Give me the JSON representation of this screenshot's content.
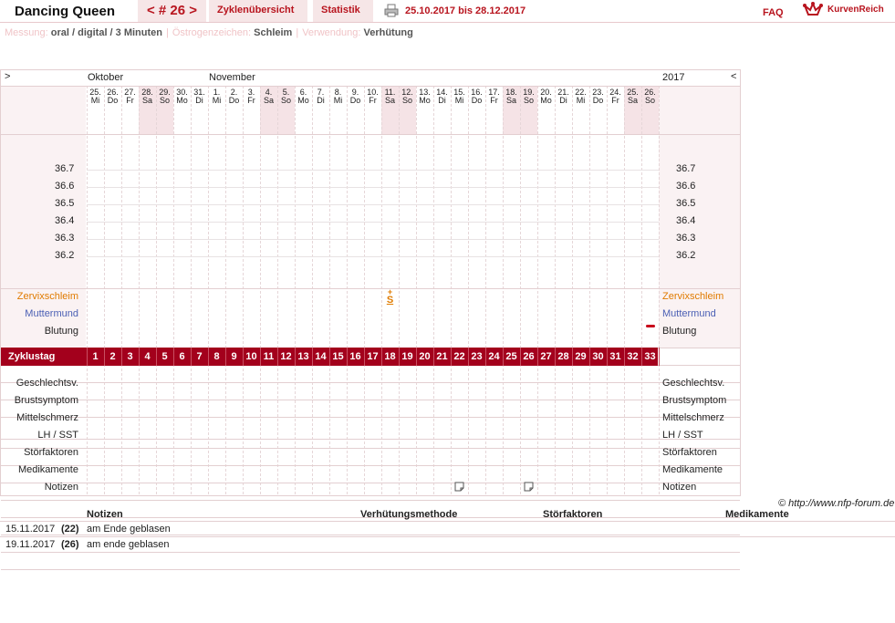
{
  "header": {
    "title": "Dancing Queen",
    "cycle_nav": "< # 26 >",
    "tab_overview": "Zyklenübersicht",
    "tab_stats": "Statistik",
    "date_range": "25.10.2017 bis 28.12.2017",
    "faq": "FAQ",
    "logo_text": "KurvenReich",
    "brand_color": "#b8141e"
  },
  "meta": {
    "measure_label": "Messung:",
    "measure_value": "oral / digital / 3 Minuten",
    "estrogen_label": "Östrogenzeichen:",
    "estrogen_value": "Schleim",
    "usage_label": "Verwendung:",
    "usage_value": "Verhütung"
  },
  "chart": {
    "nav_left": ">",
    "nav_right": "<",
    "month_1": "Oktober",
    "month_2": "November",
    "year": "2017",
    "days": [
      {
        "d": "25.",
        "w": "Mi"
      },
      {
        "d": "26.",
        "w": "Do"
      },
      {
        "d": "27.",
        "w": "Fr"
      },
      {
        "d": "28.",
        "w": "Sa"
      },
      {
        "d": "29.",
        "w": "So"
      },
      {
        "d": "30.",
        "w": "Mo"
      },
      {
        "d": "31.",
        "w": "Di"
      },
      {
        "d": "1.",
        "w": "Mi"
      },
      {
        "d": "2.",
        "w": "Do"
      },
      {
        "d": "3.",
        "w": "Fr"
      },
      {
        "d": "4.",
        "w": "Sa"
      },
      {
        "d": "5.",
        "w": "So"
      },
      {
        "d": "6.",
        "w": "Mo"
      },
      {
        "d": "7.",
        "w": "Di"
      },
      {
        "d": "8.",
        "w": "Mi"
      },
      {
        "d": "9.",
        "w": "Do"
      },
      {
        "d": "10.",
        "w": "Fr"
      },
      {
        "d": "11.",
        "w": "Sa"
      },
      {
        "d": "12.",
        "w": "So"
      },
      {
        "d": "13.",
        "w": "Mo"
      },
      {
        "d": "14.",
        "w": "Di"
      },
      {
        "d": "15.",
        "w": "Mi"
      },
      {
        "d": "16.",
        "w": "Do"
      },
      {
        "d": "17.",
        "w": "Fr"
      },
      {
        "d": "18.",
        "w": "Sa"
      },
      {
        "d": "19.",
        "w": "So"
      },
      {
        "d": "20.",
        "w": "Mo"
      },
      {
        "d": "21.",
        "w": "Di"
      },
      {
        "d": "22.",
        "w": "Mi"
      },
      {
        "d": "23.",
        "w": "Do"
      },
      {
        "d": "24.",
        "w": "Fr"
      },
      {
        "d": "25.",
        "w": "Sa"
      },
      {
        "d": "26.",
        "w": "So"
      }
    ],
    "temps": [
      "36.7",
      "36.6",
      "36.5",
      "36.4",
      "36.3",
      "36.2"
    ],
    "cervix_label": "Zervixschleim",
    "cervix_mark": "S",
    "cervix_day": 18,
    "os_label": "Muttermund",
    "bleeding_label": "Blutung",
    "bleeding_day": 33,
    "cycle_label": "Zyklustag",
    "cycle_days": [
      "1",
      "2",
      "3",
      "4",
      "5",
      "6",
      "7",
      "8",
      "9",
      "10",
      "11",
      "12",
      "13",
      "14",
      "15",
      "16",
      "17",
      "18",
      "19",
      "20",
      "21",
      "22",
      "23",
      "24",
      "25",
      "26",
      "27",
      "28",
      "29",
      "30",
      "31",
      "32",
      "33"
    ],
    "rows": [
      "Geschlechtsv.",
      "Brustsymptom",
      "Mittelschmerz",
      "LH / SST",
      "Störfaktoren",
      "Medikamente",
      "Notizen"
    ],
    "note_days": [
      22,
      26
    ],
    "cervix_color": "#e07b00",
    "os_color": "#4a5fb4",
    "cycle_bar_color": "#a3001c"
  },
  "copyright": "© http://www.nfp-forum.de",
  "notes_table": {
    "headers": [
      "Notizen",
      "Verhütungsmethode",
      "Störfaktoren",
      "Medikamente"
    ],
    "rows": [
      {
        "date": "15.11.2017",
        "day": "(22)",
        "note": "am Ende geblasen"
      },
      {
        "date": "19.11.2017",
        "day": "(26)",
        "note": "am ende geblasen"
      }
    ]
  }
}
